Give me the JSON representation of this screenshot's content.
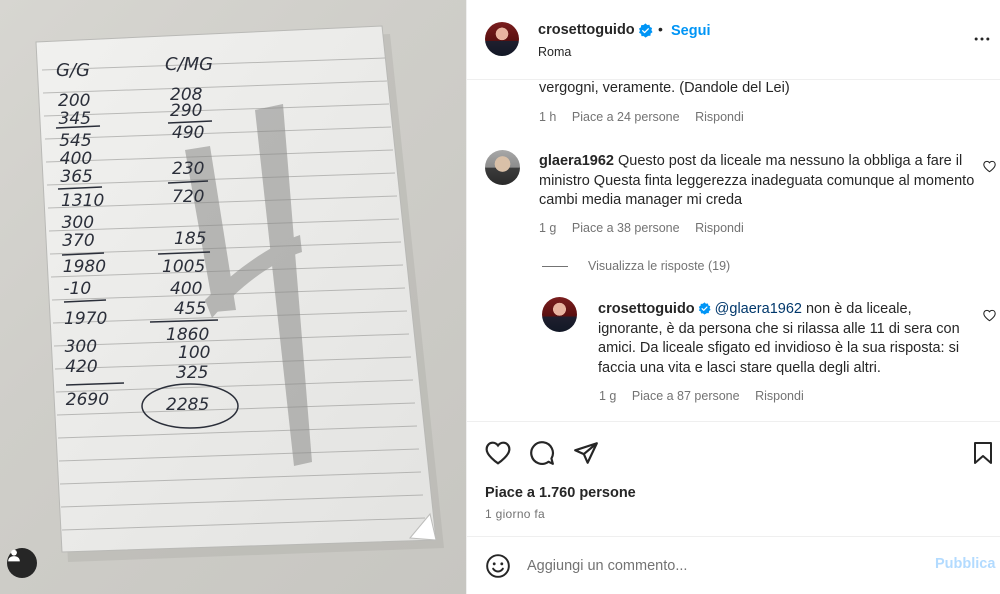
{
  "post": {
    "image": {
      "description_icon": "user-tag-icon",
      "notes": {
        "col1_header": "G/G",
        "col2_header": "C/MG",
        "col1": [
          "200",
          "345",
          "545",
          "400",
          "365",
          "1310",
          "300",
          "370",
          "1980",
          "-10",
          "1970",
          "300",
          "420",
          "2690"
        ],
        "col2": [
          "208",
          "290",
          "490",
          "230",
          "720",
          "185",
          "1005",
          "400",
          "455",
          "1860",
          "100",
          "325",
          "2285"
        ]
      }
    },
    "header": {
      "username": "crosettoguido",
      "verified_icon": "verified-badge-icon",
      "separator": "•",
      "follow_label": "Segui",
      "location": "Roma",
      "more_icon": "more-options-icon"
    },
    "comments": [
      {
        "text": "vergogni, veramente. (Dandole del Lei)",
        "time": "1 h",
        "likes": "Piace a 24 persone",
        "reply_label": "Rispondi"
      },
      {
        "username": "glaera1962",
        "text": "Questo post da liceale ma nessuno la obbliga a fare il ministro Questa finta leggerezza inadeguata comunque al momento cambi media manager mi creda",
        "time": "1 g",
        "likes": "Piace a 38 persone",
        "reply_label": "Rispondi",
        "view_replies": "Visualizza le risposte (19)",
        "replies": [
          {
            "username": "crosettoguido",
            "mention": "@glaera1962",
            "text": " non è da liceale, ignorante, è da persona che si rilassa alle 11 di sera con amici. Da liceale sfigato ed invidioso è la sua risposta: si faccia una vita e lasci stare quella degli altri.",
            "time": "1 g",
            "likes": "Piace a 87 persone",
            "reply_label": "Rispondi"
          }
        ]
      }
    ],
    "actions": {
      "like_icon": "heart-icon",
      "comment_icon": "comment-icon",
      "share_icon": "share-icon",
      "save_icon": "bookmark-icon",
      "likes_count": "Piace a 1.760 persone",
      "date": "1 giorno fa"
    },
    "composer": {
      "emoji_icon": "emoji-icon",
      "placeholder": "Aggiungi un commento...",
      "publish_label": "Pubblica"
    },
    "colors": {
      "accent": "#0095f6",
      "publish_disabled": "#b3dbff",
      "text": "#262626",
      "secondary": "#737373",
      "mention": "#00376b"
    }
  }
}
